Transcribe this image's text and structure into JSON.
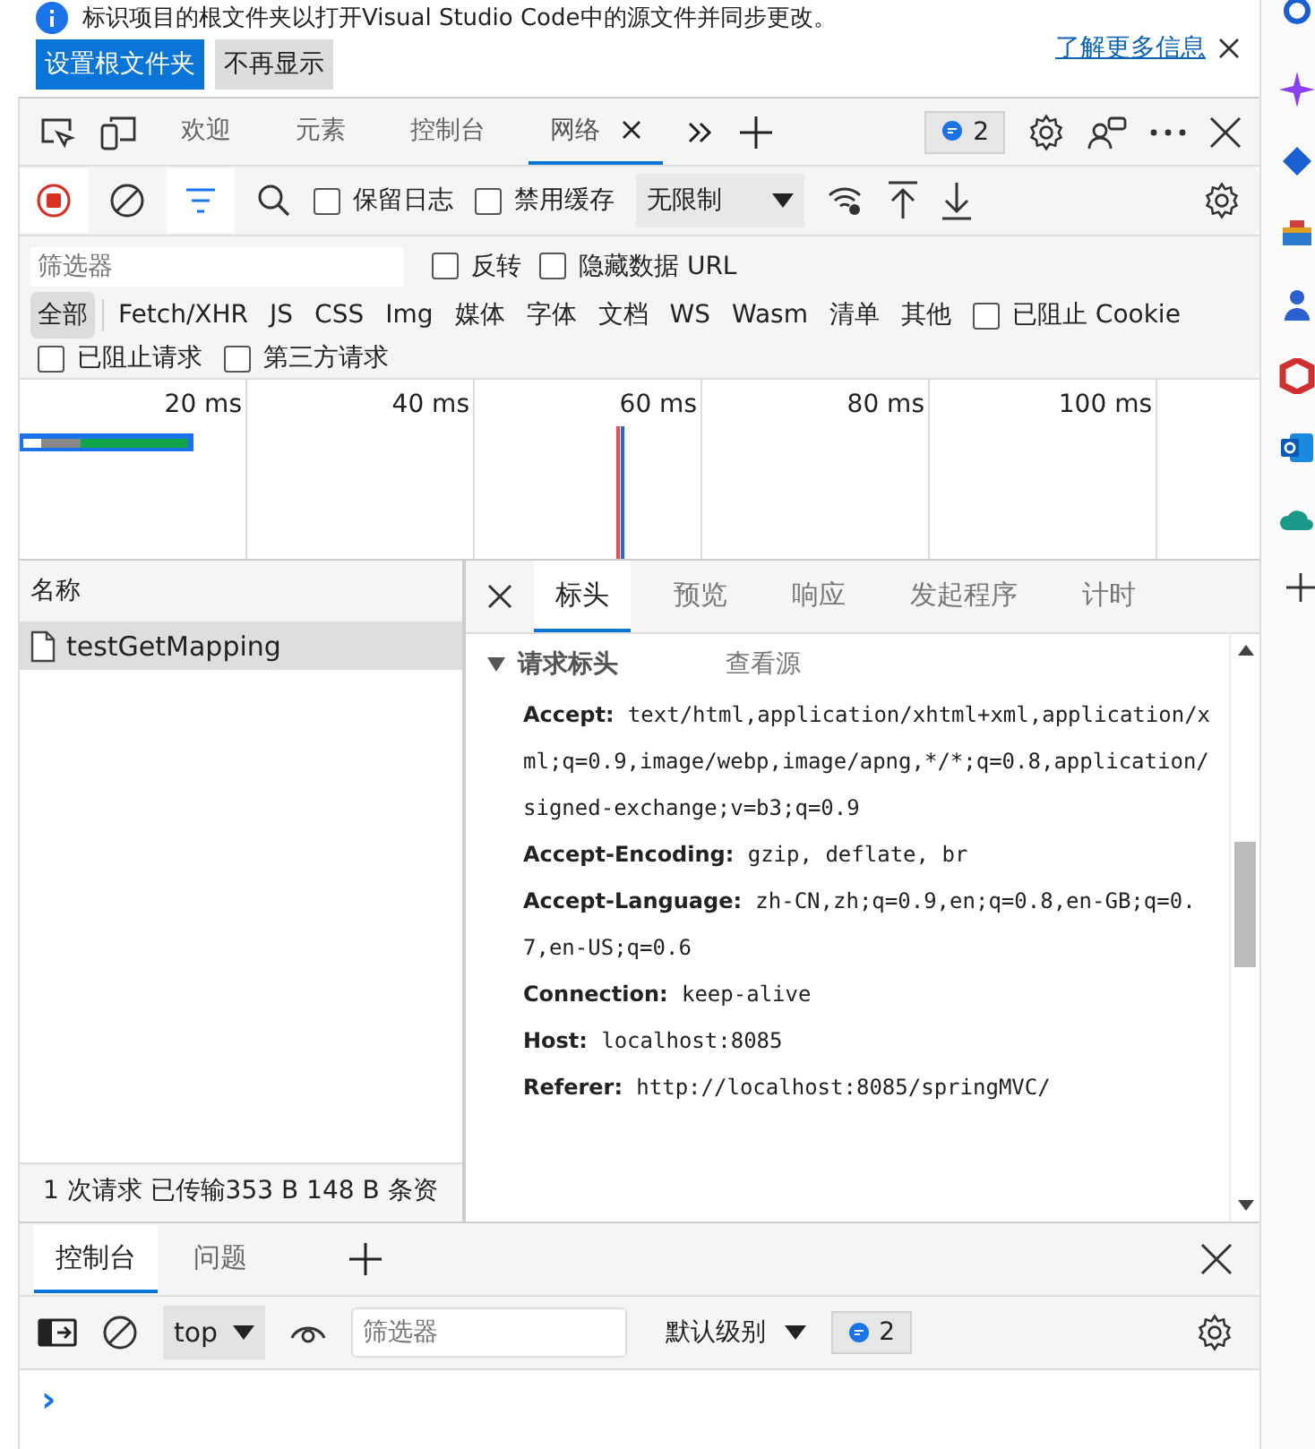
{
  "infobar": {
    "message": "标识项目的根文件夹以打开Visual Studio Code中的源文件并同步更改。",
    "primary_button": "设置根文件夹",
    "secondary_button": "不再显示",
    "link": "了解更多信息"
  },
  "devtools_tabs": [
    {
      "label": "欢迎",
      "selected": false,
      "closable": false
    },
    {
      "label": "元素",
      "selected": false,
      "closable": false
    },
    {
      "label": "控制台",
      "selected": false,
      "closable": false
    },
    {
      "label": "网络",
      "selected": true,
      "closable": true
    }
  ],
  "issues_count": "2",
  "toolbar": {
    "recording": true,
    "preserve_log": {
      "label": "保留日志",
      "checked": false
    },
    "disable_cache": {
      "label": "禁用缓存",
      "checked": false
    },
    "throttling": "无限制"
  },
  "filter": {
    "placeholder": "筛选器",
    "invert": {
      "label": "反转",
      "checked": false
    },
    "hide_data_urls": {
      "label": "隐藏数据 URL",
      "checked": false
    }
  },
  "type_filters": [
    {
      "label": "全部",
      "selected": true
    },
    {
      "label": "Fetch/XHR",
      "selected": false
    },
    {
      "label": "JS",
      "selected": false
    },
    {
      "label": "CSS",
      "selected": false
    },
    {
      "label": "Img",
      "selected": false
    },
    {
      "label": "媒体",
      "selected": false
    },
    {
      "label": "字体",
      "selected": false
    },
    {
      "label": "文档",
      "selected": false
    },
    {
      "label": "WS",
      "selected": false
    },
    {
      "label": "Wasm",
      "selected": false
    },
    {
      "label": "清单",
      "selected": false
    },
    {
      "label": "其他",
      "selected": false
    }
  ],
  "extra_filters": [
    {
      "label": "已阻止 Cookie",
      "checked": false
    },
    {
      "label": "已阻止请求",
      "checked": false
    },
    {
      "label": "第三方请求",
      "checked": false
    }
  ],
  "timeline": {
    "ticks": [
      "20 ms",
      "40 ms",
      "60 ms",
      "80 ms",
      "100 ms"
    ]
  },
  "requests": {
    "column": "名称",
    "rows": [
      {
        "name": "testGetMapping",
        "selected": true
      }
    ],
    "summary": "1 次请求  已传输353 B  148 B 条资"
  },
  "detail_tabs": [
    {
      "label": "标头",
      "selected": true
    },
    {
      "label": "预览",
      "selected": false
    },
    {
      "label": "响应",
      "selected": false
    },
    {
      "label": "发起程序",
      "selected": false
    },
    {
      "label": "计时",
      "selected": false
    }
  ],
  "request_headers": {
    "title": "请求标头",
    "expanded": true,
    "view_source": "查看源",
    "headers": [
      {
        "name": "Accept:",
        "value": "text/html,application/xhtml+xml,application/xml;q=0.9,image/webp,image/apng,*/*;q=0.8,application/signed-exchange;v=b3;q=0.9"
      },
      {
        "name": "Accept-Encoding:",
        "value": "gzip, deflate, br"
      },
      {
        "name": "Accept-Language:",
        "value": "zh-CN,zh;q=0.9,en;q=0.8,en-GB;q=0.7,en-US;q=0.6"
      },
      {
        "name": "Connection:",
        "value": "keep-alive"
      },
      {
        "name": "Host:",
        "value": "localhost:8085"
      },
      {
        "name": "Referer:",
        "value": "http://localhost:8085/springMVC/"
      }
    ]
  },
  "drawer_tabs": [
    {
      "label": "控制台",
      "selected": true
    },
    {
      "label": "问题",
      "selected": false
    }
  ],
  "console": {
    "context": "top",
    "filter_placeholder": "筛选器",
    "level": "默认级别",
    "issues_count": "2",
    "prompt": "›"
  }
}
